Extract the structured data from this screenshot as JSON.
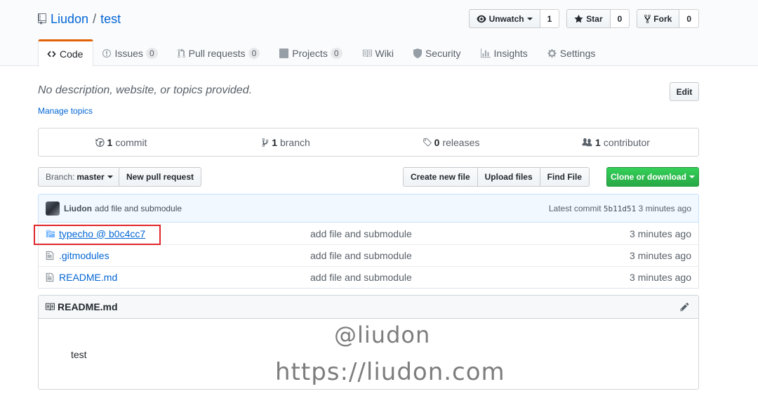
{
  "repo": {
    "owner": "Liudon",
    "separator": "/",
    "name": "test"
  },
  "actions": {
    "watch": {
      "label": "Unwatch",
      "count": "1"
    },
    "star": {
      "label": "Star",
      "count": "0"
    },
    "fork": {
      "label": "Fork",
      "count": "0"
    }
  },
  "tabs": [
    {
      "label": "Code"
    },
    {
      "label": "Issues",
      "count": "0"
    },
    {
      "label": "Pull requests",
      "count": "0"
    },
    {
      "label": "Projects",
      "count": "0"
    },
    {
      "label": "Wiki"
    },
    {
      "label": "Security"
    },
    {
      "label": "Insights"
    },
    {
      "label": "Settings"
    }
  ],
  "description": "No description, website, or topics provided.",
  "manage_topics": "Manage topics",
  "edit_label": "Edit",
  "summary": {
    "commits": {
      "count": "1",
      "label": "commit"
    },
    "branches": {
      "count": "1",
      "label": "branch"
    },
    "releases": {
      "count": "0",
      "label": "releases"
    },
    "contributors": {
      "count": "1",
      "label": "contributor"
    }
  },
  "toolbar": {
    "branch_prefix": "Branch:",
    "branch": "master",
    "new_pr": "New pull request",
    "create_file": "Create new file",
    "upload_files": "Upload files",
    "find_file": "Find File",
    "clone": "Clone or download"
  },
  "commit": {
    "author": "Liudon",
    "message": "add file and submodule",
    "latest_prefix": "Latest commit",
    "sha": "5b11d51",
    "age": "3 minutes ago"
  },
  "files": [
    {
      "name": "typecho @ b0c4cc7",
      "message": "add file and submodule",
      "age": "3 minutes ago"
    },
    {
      "name": ".gitmodules",
      "message": "add file and submodule",
      "age": "3 minutes ago"
    },
    {
      "name": "README.md",
      "message": "add file and submodule",
      "age": "3 minutes ago"
    }
  ],
  "readme": {
    "title": "README.md",
    "content": "test"
  },
  "watermark": {
    "line1": "@liudon",
    "line2": "https://liudon.com"
  },
  "colors": {
    "accent": "#0366d6",
    "tab_highlight": "#e36209",
    "clone": "#28a745",
    "annotation": "#e0262c"
  }
}
